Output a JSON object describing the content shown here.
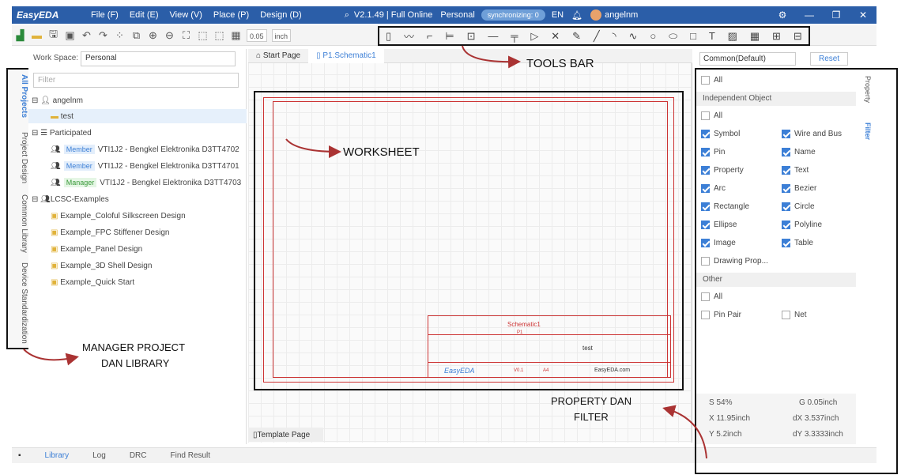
{
  "titlebar": {
    "app": "EasyEDA",
    "menus": [
      "File (F)",
      "Edit (E)",
      "View (V)",
      "Place (P)",
      "Design (D)"
    ],
    "version": "V2.1.49 | Full Online",
    "plan": "Personal",
    "sync": "synchronizing: 0",
    "lang": "EN",
    "user": "angelnm"
  },
  "toolbar": {
    "grid": "0.05",
    "unit": "inch"
  },
  "leftpanel": {
    "workspace_label": "Work Space:",
    "workspace_value": "Personal",
    "filter_placeholder": "Filter",
    "user": "angelnm",
    "project": "test",
    "participated": "Participated",
    "members": [
      {
        "role": "Member",
        "name": "VTI1J2 - Bengkel Elektronika D3TT4702"
      },
      {
        "role": "Member",
        "name": "VTI1J2 - Bengkel Elektronika D3TT4701"
      },
      {
        "role": "Manager",
        "name": "VTI1J2 - Bengkel Elektronika D3TT4703"
      }
    ],
    "examples_title": "LCSC-Examples",
    "examples": [
      "Example_Coloful Silkscreen Design",
      "Example_FPC Stiffener Design",
      "Example_Panel Design",
      "Example_3D Shell Design",
      "Example_Quick Start"
    ]
  },
  "sidetabs": [
    "All Projects",
    "Project Design",
    "Common Library",
    "Device Standardization"
  ],
  "doctabs": {
    "start": "Start Page",
    "schematic": "P1.Schematic1"
  },
  "titleblock": {
    "title": "Schematic1",
    "page": "P1",
    "name": "test",
    "brand": "EasyEDA",
    "site": "EasyEDA.com",
    "version": "V0.1",
    "size": "A4"
  },
  "template": "Template Page",
  "bottom": [
    "Library",
    "Log",
    "DRC",
    "Find Result"
  ],
  "rightpanel": {
    "preset": "Common(Default)",
    "reset": "Reset",
    "all": "All",
    "independent": "Independent Object",
    "other": "Other",
    "left_items": [
      "Symbol",
      "Pin",
      "Property",
      "Arc",
      "Rectangle",
      "Ellipse",
      "Image",
      "Drawing Prop..."
    ],
    "right_items": [
      "Wire and Bus",
      "Name",
      "Text",
      "Bezier",
      "Circle",
      "Polyline",
      "Table"
    ],
    "other_items": [
      "Pin Pair",
      "Net"
    ],
    "tabs": [
      "Property",
      "Filter"
    ]
  },
  "stats": {
    "s": "S  54%",
    "g": "G  0.05inch",
    "x": "X  11.95inch",
    "dx": "dX  3.537inch",
    "y": "Y  5.2inch",
    "dy": "dY  3.3333inch"
  },
  "annotations": {
    "tools": "TOOLS BAR",
    "worksheet": "WORKSHEET",
    "manager1": "MANAGER PROJECT",
    "manager2": "DAN LIBRARY",
    "prop1": "PROPERTY DAN",
    "prop2": "FILTER"
  }
}
